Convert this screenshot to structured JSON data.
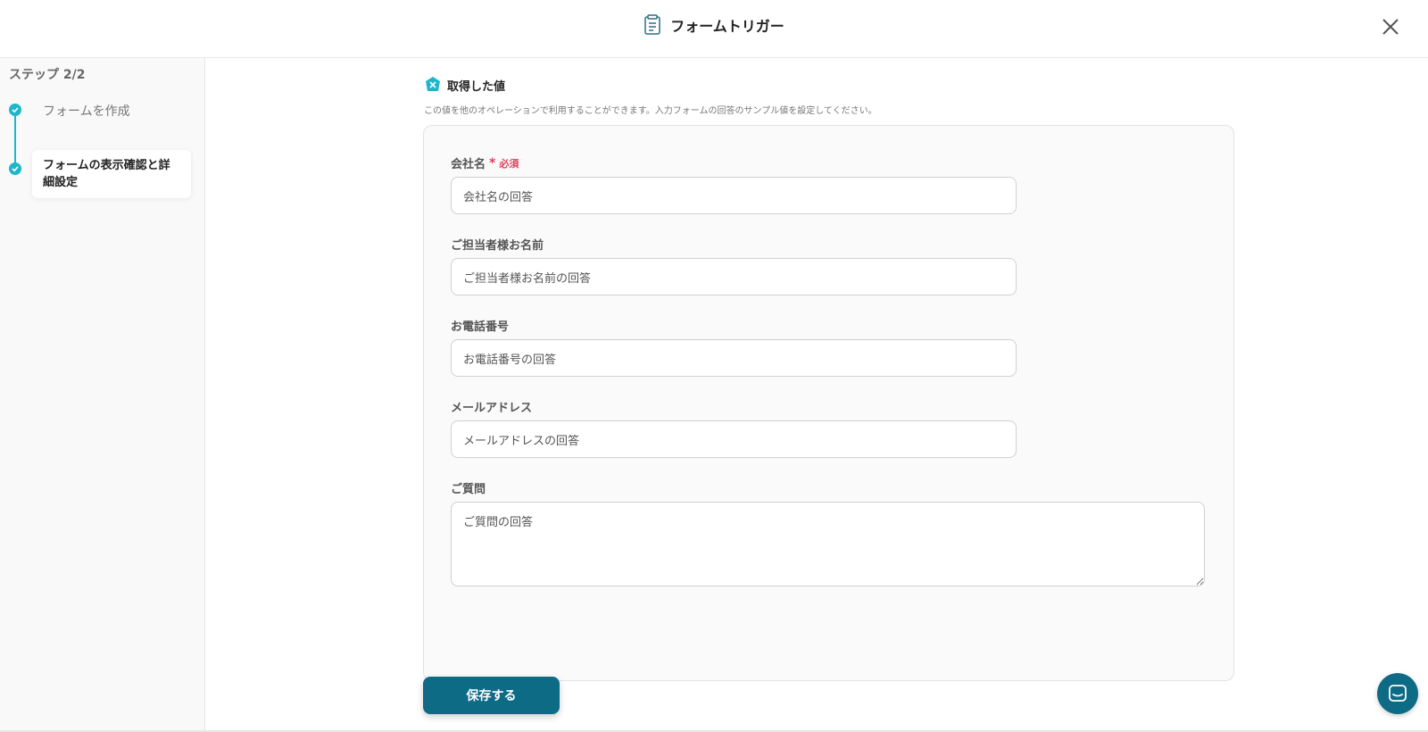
{
  "header": {
    "title": "フォームトリガー",
    "title_icon": "form-trigger-icon",
    "close_icon": "close-icon"
  },
  "sidebar": {
    "step_counter": "ステップ 2/2",
    "steps": [
      {
        "label": "フォームを作成",
        "status": "completed",
        "icon": "check-icon"
      },
      {
        "label": "フォームの表示確認と詳細設定",
        "status": "current",
        "icon": "check-icon"
      }
    ]
  },
  "section": {
    "title": "取得した値",
    "icon": "yoom-badge-icon",
    "description": "この値を他のオペレーションで利用することができます。入力フォームの回答のサンプル値を設定してください。"
  },
  "fields": [
    {
      "label": "会社名",
      "required": true,
      "required_text": "必須",
      "value": "会社名の回答"
    },
    {
      "label": "ご担当者様お名前",
      "required": false,
      "value": "ご担当者様お名前の回答"
    },
    {
      "label": "お電話番号",
      "required": false,
      "value": "お電話番号の回答"
    },
    {
      "label": "メールアドレス",
      "required": false,
      "value": "メールアドレスの回答"
    },
    {
      "label": "ご質問",
      "required": false,
      "value": "ご質問の回答",
      "multiline": true
    }
  ],
  "actions": {
    "save_label": "保存する"
  },
  "chat": {
    "icon": "chat-icon"
  },
  "colors": {
    "accent": "#1fb6c9",
    "primary": "#0e6b86",
    "required": "#e0405a"
  }
}
